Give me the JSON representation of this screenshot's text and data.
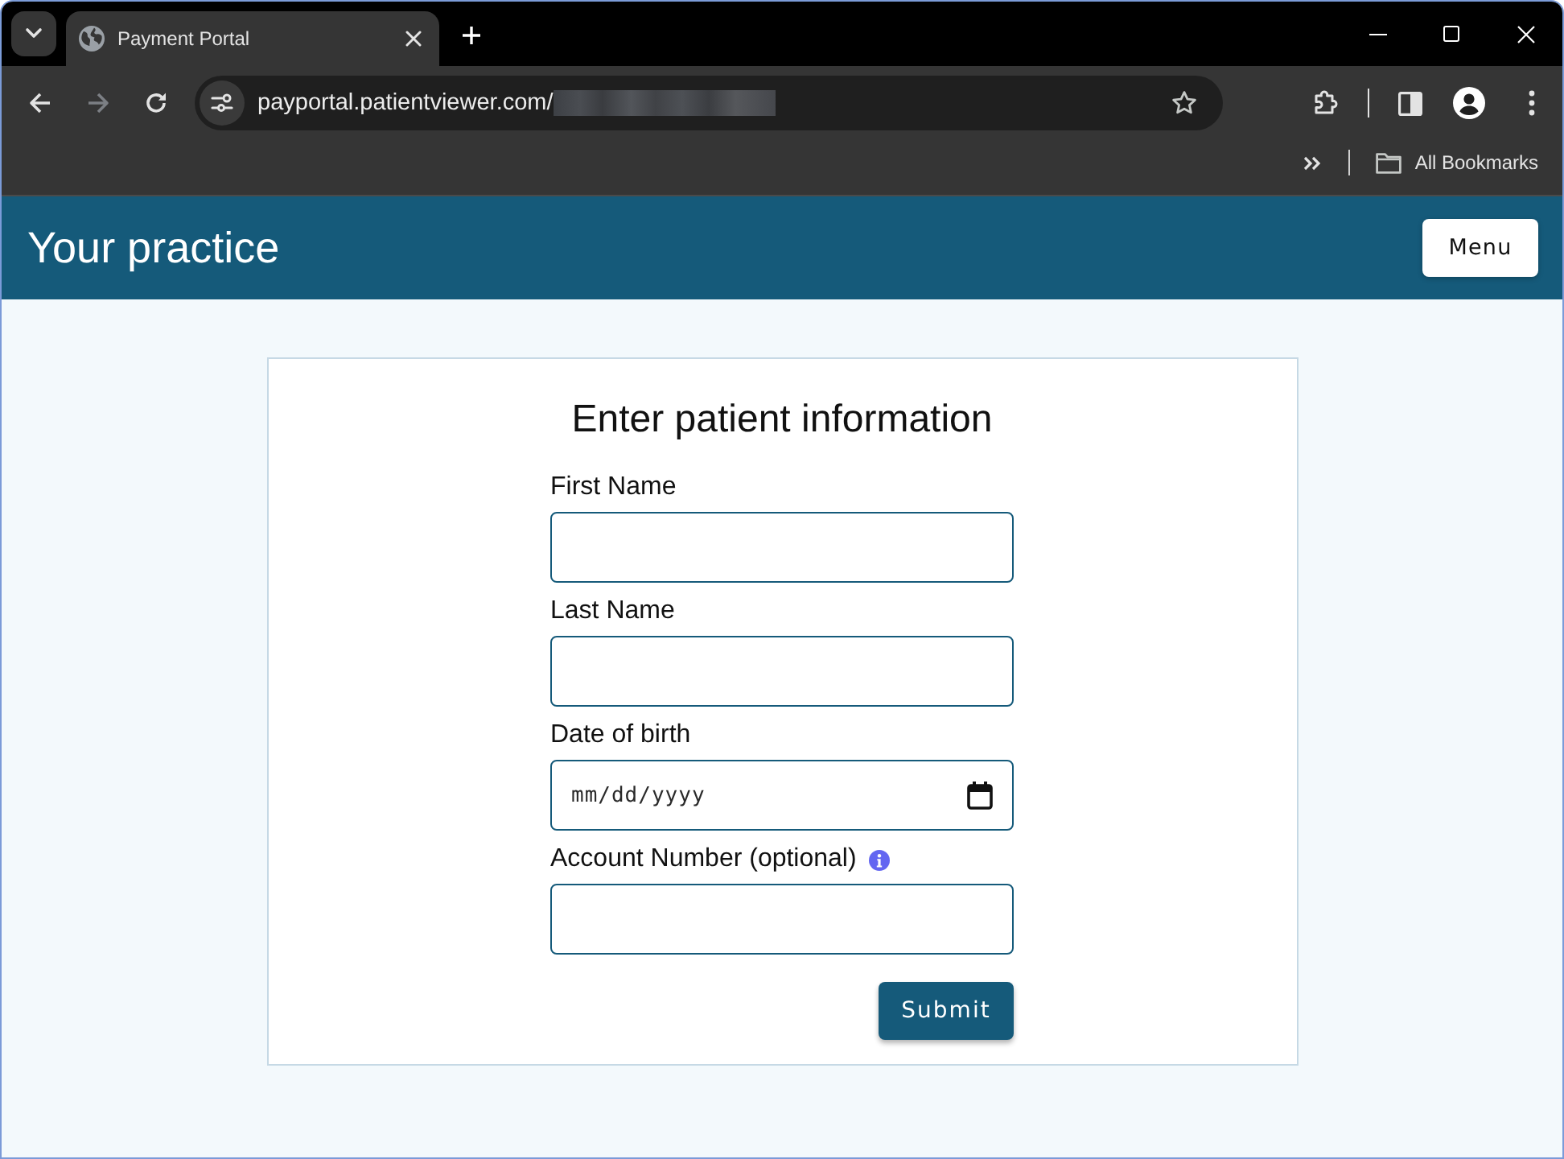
{
  "browser": {
    "tabs": [
      {
        "title": "Payment Portal",
        "selected": true
      }
    ],
    "toolbar": {
      "back_disabled": false,
      "forward_disabled": true
    },
    "address": {
      "url": "payportal.patientviewer.com/",
      "path_redacted": true
    },
    "bookmarks_bar": {
      "folder": "All Bookmarks"
    }
  },
  "header": {
    "title": "Your practice",
    "menu_button": "Menu"
  },
  "form": {
    "title": "Enter patient information",
    "fields": [
      {
        "kind": "text",
        "label": "First Name"
      },
      {
        "kind": "text",
        "label": "Last Name"
      },
      {
        "kind": "date",
        "label": "Date of birth",
        "placeholder": "mm/dd/yyyy"
      },
      {
        "kind": "text",
        "label": "Account Number (optional)",
        "info": true
      }
    ],
    "submit_button": "Submit"
  }
}
